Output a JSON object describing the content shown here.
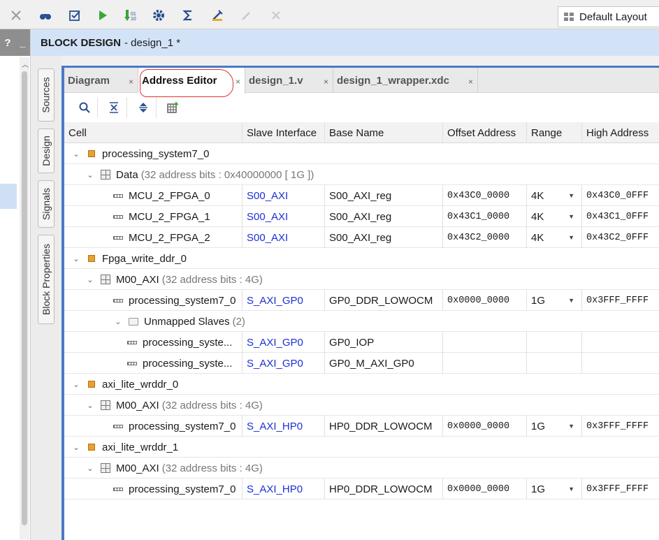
{
  "toolbar": {
    "icons": [
      "close-icon",
      "binoculars-icon",
      "checkbox-icon",
      "run-icon",
      "program-device-icon",
      "settings-gear-icon",
      "sigma-icon",
      "tool-disabled-icon",
      "wand-disabled-icon",
      "cross-disabled-icon"
    ],
    "layout_label": "Default Layout"
  },
  "left_panel": {
    "help": "?",
    "minimize": "_"
  },
  "header": {
    "title": "BLOCK DESIGN",
    "subtitle": "- design_1 *"
  },
  "side_tabs": [
    "Sources",
    "Design",
    "Signals",
    "Block Properties"
  ],
  "tabs": [
    {
      "label": "Diagram",
      "active": false
    },
    {
      "label": "Address Editor",
      "active": true
    },
    {
      "label": "design_1.v",
      "active": false
    },
    {
      "label": "design_1_wrapper.xdc",
      "active": false
    }
  ],
  "tab_close": "×",
  "columns": [
    "Cell",
    "Slave Interface",
    "Base Name",
    "Offset Address",
    "Range",
    "High Address"
  ],
  "rows": [
    {
      "kind": "ip",
      "level": 0,
      "name": "processing_system7_0"
    },
    {
      "kind": "space",
      "level": 1,
      "name": "Data",
      "detail": "(32 address bits : 0x40000000 [ 1G ])"
    },
    {
      "kind": "seg",
      "level": 2,
      "name": "MCU_2_FPGA_0",
      "iface": "S00_AXI",
      "base": "S00_AXI_reg",
      "offset": "0x43C0_0000",
      "range": "4K",
      "high": "0x43C0_0FFF"
    },
    {
      "kind": "seg",
      "level": 2,
      "name": "MCU_2_FPGA_1",
      "iface": "S00_AXI",
      "base": "S00_AXI_reg",
      "offset": "0x43C1_0000",
      "range": "4K",
      "high": "0x43C1_0FFF"
    },
    {
      "kind": "seg",
      "level": 2,
      "name": "MCU_2_FPGA_2",
      "iface": "S00_AXI",
      "base": "S00_AXI_reg",
      "offset": "0x43C2_0000",
      "range": "4K",
      "high": "0x43C2_0FFF"
    },
    {
      "kind": "ip",
      "level": 0,
      "name": "Fpga_write_ddr_0"
    },
    {
      "kind": "space",
      "level": 1,
      "name": "M00_AXI",
      "detail": "(32 address bits : 4G)"
    },
    {
      "kind": "seg",
      "level": 2,
      "name": "processing_system7_0",
      "iface": "S_AXI_GP0",
      "base": "GP0_DDR_LOWOCM",
      "offset": "0x0000_0000",
      "range": "1G",
      "high": "0x3FFF_FFFF"
    },
    {
      "kind": "folder",
      "level": 2,
      "name": "Unmapped Slaves",
      "detail": "(2)"
    },
    {
      "kind": "seg",
      "level": 3,
      "name": "processing_syste...",
      "iface": "S_AXI_GP0",
      "base": "GP0_IOP",
      "offset": "",
      "range": "",
      "high": ""
    },
    {
      "kind": "seg",
      "level": 3,
      "name": "processing_syste...",
      "iface": "S_AXI_GP0",
      "base": "GP0_M_AXI_GP0",
      "offset": "",
      "range": "",
      "high": ""
    },
    {
      "kind": "ip",
      "level": 0,
      "name": "axi_lite_wrddr_0"
    },
    {
      "kind": "space",
      "level": 1,
      "name": "M00_AXI",
      "detail": "(32 address bits : 4G)"
    },
    {
      "kind": "seg",
      "level": 2,
      "name": "processing_system7_0",
      "iface": "S_AXI_HP0",
      "base": "HP0_DDR_LOWOCM",
      "offset": "0x0000_0000",
      "range": "1G",
      "high": "0x3FFF_FFFF"
    },
    {
      "kind": "ip",
      "level": 0,
      "name": "axi_lite_wrddr_1"
    },
    {
      "kind": "space",
      "level": 1,
      "name": "M00_AXI",
      "detail": "(32 address bits : 4G)"
    },
    {
      "kind": "seg",
      "level": 2,
      "name": "processing_system7_0",
      "iface": "S_AXI_HP0",
      "base": "HP0_DDR_LOWOCM",
      "offset": "0x0000_0000",
      "range": "1G",
      "high": "0x3FFF_FFFF"
    }
  ]
}
